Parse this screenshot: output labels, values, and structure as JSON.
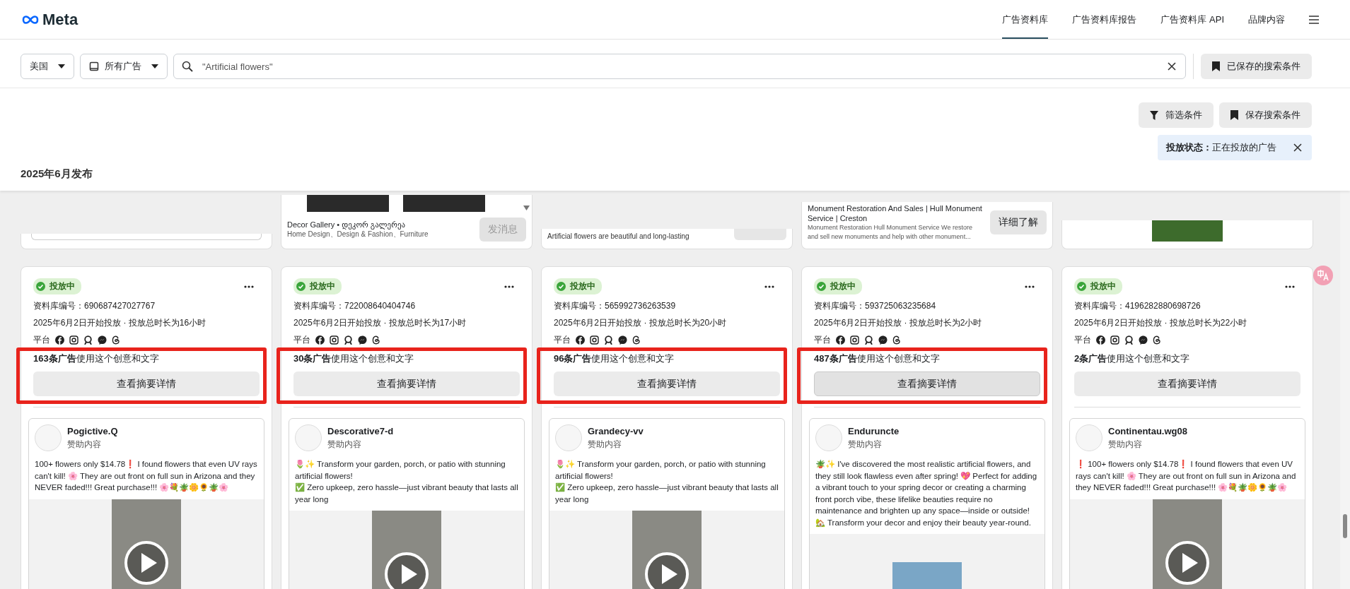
{
  "header": {
    "logo": "Meta",
    "nav": [
      {
        "label": "广告资料库",
        "selected": true
      },
      {
        "label": "广告资料库报告",
        "selected": false
      },
      {
        "label": "广告资料库 API",
        "selected": false
      },
      {
        "label": "品牌内容",
        "selected": false
      }
    ]
  },
  "search_bar": {
    "country": "美国",
    "ad_type": "所有广告",
    "query": "\"Artificial flowers\"",
    "saved_button": "已保存的搜索条件"
  },
  "filter_buttons": [
    {
      "kind": "filter",
      "label": "筛选条件"
    },
    {
      "kind": "save",
      "label": "保存搜索条件"
    }
  ],
  "active_filter": {
    "text": "**投放状态：**正在投放的广告"
  },
  "section_heading": "2025年6月发布",
  "previous_cards": [
    {
      "kind": "blank"
    },
    {
      "kind": "message",
      "page_name": "Decor Gallery • დეკორ გალერეა",
      "categories": "Home Design、Design & Fashion、Furniture",
      "button": "发消息"
    },
    {
      "kind": "caption",
      "text": "Artificial flowers are beautiful and long-lasting"
    },
    {
      "kind": "link",
      "title": "Monument Restoration And Sales | Hull Monument Service | Creston",
      "description": "Monument Restoration Hull Monument Service We restore and sell new monuments and help with other monument...",
      "button": "详细了解"
    },
    {
      "kind": "image"
    }
  ],
  "ads": [
    {
      "status": "投放中",
      "library_id": "资料库编号：690687427027767",
      "run_info": "2025年6月2日开始投放 · 投放总时长为16小时",
      "platform_label": "平台",
      "usage": "**163条广告**使用这个创意和文字",
      "details_button": "查看摘要详情",
      "hovered": false,
      "highlighted": true,
      "advertiser": "Pogictive.Q",
      "sponsored": "赞助内容",
      "body": "100+ flowers only $14.78❗ I found flowers that even UV rays can't kill! 🌸 They are out front on full sun in Arizona and they NEVER faded!!! Great purchase!!! 🌸💐🪴🌼🌻🪴🌸",
      "kind": "video"
    },
    {
      "status": "投放中",
      "library_id": "资料库编号：722008640404746",
      "run_info": "2025年6月2日开始投放 · 投放总时长为17小时",
      "platform_label": "平台",
      "usage": "**30条广告**使用这个创意和文字",
      "details_button": "查看摘要详情",
      "hovered": false,
      "highlighted": true,
      "advertiser": "Descorative7-d",
      "sponsored": "赞助内容",
      "body": "🌷✨ Transform your garden, porch, or patio with stunning artificial flowers!\n✅ Zero upkeep, zero hassle—just vibrant beauty that lasts all year long",
      "kind": "video"
    },
    {
      "status": "投放中",
      "library_id": "资料库编号：565992736263539",
      "run_info": "2025年6月2日开始投放 · 投放总时长为20小时",
      "platform_label": "平台",
      "usage": "**96条广告**使用这个创意和文字",
      "details_button": "查看摘要详情",
      "hovered": false,
      "highlighted": true,
      "advertiser": "Grandecy-vv",
      "sponsored": "赞助内容",
      "body": "🌷✨ Transform your garden, porch, or patio with stunning artificial flowers!\n✅ Zero upkeep, zero hassle—just vibrant beauty that lasts all year long",
      "kind": "video"
    },
    {
      "status": "投放中",
      "library_id": "资料库编号：593725063235684",
      "run_info": "2025年6月2日开始投放 · 投放总时长为2小时",
      "platform_label": "平台",
      "usage": "**487条广告**使用这个创意和文字",
      "details_button": "查看摘要详情",
      "hovered": true,
      "highlighted": true,
      "advertiser": "Enduruncte",
      "sponsored": "赞助内容",
      "body": "🪴✨ I've discovered the most realistic artificial flowers, and they still look flawless even after spring! 💖 Perfect for adding a vibrant touch to your spring decor or creating a charming front porch vibe, these lifelike beauties require no maintenance and brighten up any space—inside or outside! 🏡 Transform your decor and enjoy their beauty year-round.",
      "kind": "image"
    },
    {
      "status": "投放中",
      "library_id": "资料库编号：4196282880698726",
      "run_info": "2025年6月2日开始投放 · 投放总时长为22小时",
      "platform_label": "平台",
      "usage": "**2条广告**使用这个创意和文字",
      "details_button": "查看摘要详情",
      "hovered": false,
      "highlighted": false,
      "advertiser": "Continentau.wg08",
      "sponsored": "赞助内容",
      "body": "❗ 100+ flowers only $14.78❗ I found flowers that even UV rays can't kill! 🌸 They are out front on full sun in Arizona and they NEVER faded!!! Great purchase!!! 🌸💐🪴🌼🌻🪴🌸",
      "kind": "video"
    }
  ]
}
